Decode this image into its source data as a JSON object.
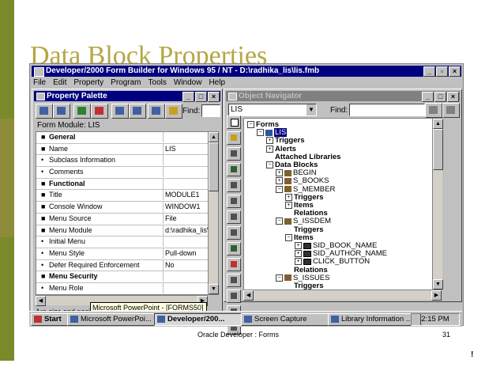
{
  "slide": {
    "title": "Data Block Properties",
    "footer": "Oracle Developer : Forms",
    "page_number": "31",
    "corner_mark": "!"
  },
  "app": {
    "title": "Developer/2000 Form Builder for Windows 95 / NT - D:\\radhika_lis\\lis.fmb",
    "menu": [
      "File",
      "Edit",
      "Property",
      "Program",
      "Tools",
      "Window",
      "Help"
    ]
  },
  "property_palette": {
    "title": "Property Palette",
    "find_label": "Find:",
    "find_value": "",
    "context_label": "Form Module: LIS",
    "rows": [
      {
        "kind": "section",
        "mark": "■",
        "name": "General",
        "value": ""
      },
      {
        "kind": "prop",
        "mark": "■",
        "name": "Name",
        "value": "LIS"
      },
      {
        "kind": "prop",
        "mark": "•",
        "name": "Subclass Information",
        "value": ""
      },
      {
        "kind": "prop",
        "mark": "•",
        "name": "Comments",
        "value": ""
      },
      {
        "kind": "section",
        "mark": "■",
        "name": "Functional",
        "value": ""
      },
      {
        "kind": "prop",
        "mark": "■",
        "name": "Title",
        "value": "MODULE1"
      },
      {
        "kind": "prop",
        "mark": "■",
        "name": "Console Window",
        "value": "WINDOW1"
      },
      {
        "kind": "prop",
        "mark": "■",
        "name": "Menu Source",
        "value": "File"
      },
      {
        "kind": "prop",
        "mark": "■",
        "name": "Menu Module",
        "value": "d:\\radhika_lis\\l"
      },
      {
        "kind": "prop",
        "mark": "•",
        "name": "Initial Menu",
        "value": ""
      },
      {
        "kind": "prop",
        "mark": "•",
        "name": "Menu Style",
        "value": "Pull-down"
      },
      {
        "kind": "prop",
        "mark": "•",
        "name": "Defer Required Enforcement",
        "value": "No"
      },
      {
        "kind": "section",
        "mark": "■",
        "name": "Menu Security",
        "value": ""
      },
      {
        "kind": "prop",
        "mark": "•",
        "name": "Menu Role",
        "value": ""
      }
    ],
    "hint": "Are size and position values given in character cell va"
  },
  "object_navigator": {
    "title": "Object Navigator",
    "module_select": "LIS",
    "find_label": "Find:",
    "find_value": "",
    "tree": [
      {
        "indent": 0,
        "pm": "−",
        "icon": "",
        "text": "Forms",
        "bold": true,
        "selected": false
      },
      {
        "indent": 1,
        "pm": "−",
        "icon": "form",
        "text": "LIS",
        "bold": false,
        "selected": true
      },
      {
        "indent": 2,
        "pm": "+",
        "icon": "",
        "text": "Triggers",
        "bold": true,
        "selected": false
      },
      {
        "indent": 2,
        "pm": "+",
        "icon": "",
        "text": "Alerts",
        "bold": true,
        "selected": false
      },
      {
        "indent": 2,
        "pm": "",
        "icon": "",
        "text": "Attached Libraries",
        "bold": true,
        "selected": false
      },
      {
        "indent": 2,
        "pm": "−",
        "icon": "",
        "text": "Data Blocks",
        "bold": true,
        "selected": false
      },
      {
        "indent": 3,
        "pm": "+",
        "icon": "block",
        "text": "BEGIN",
        "bold": false,
        "selected": false
      },
      {
        "indent": 3,
        "pm": "+",
        "icon": "block",
        "text": "S_BOOKS",
        "bold": false,
        "selected": false
      },
      {
        "indent": 3,
        "pm": "−",
        "icon": "block",
        "text": "S_MEMBER",
        "bold": false,
        "selected": false
      },
      {
        "indent": 4,
        "pm": "+",
        "icon": "",
        "text": "Triggers",
        "bold": true,
        "selected": false
      },
      {
        "indent": 4,
        "pm": "+",
        "icon": "",
        "text": "Items",
        "bold": true,
        "selected": false
      },
      {
        "indent": 4,
        "pm": "",
        "icon": "",
        "text": "Relations",
        "bold": true,
        "selected": false
      },
      {
        "indent": 3,
        "pm": "−",
        "icon": "block",
        "text": "S_ISSDEM",
        "bold": false,
        "selected": false
      },
      {
        "indent": 4,
        "pm": "",
        "icon": "",
        "text": "Triggers",
        "bold": true,
        "selected": false
      },
      {
        "indent": 4,
        "pm": "−",
        "icon": "",
        "text": "Items",
        "bold": true,
        "selected": false
      },
      {
        "indent": 5,
        "pm": "+",
        "icon": "item",
        "text": "SID_BOOK_NAME",
        "bold": false,
        "selected": false
      },
      {
        "indent": 5,
        "pm": "+",
        "icon": "item",
        "text": "SID_AUTHOR_NAME",
        "bold": false,
        "selected": false
      },
      {
        "indent": 5,
        "pm": "+",
        "icon": "item",
        "text": "CLICK_BUTTON",
        "bold": false,
        "selected": false
      },
      {
        "indent": 4,
        "pm": "",
        "icon": "",
        "text": "Relations",
        "bold": true,
        "selected": false
      },
      {
        "indent": 3,
        "pm": "−",
        "icon": "block",
        "text": "S_ISSUES",
        "bold": false,
        "selected": false
      },
      {
        "indent": 4,
        "pm": "",
        "icon": "",
        "text": "Triggers",
        "bold": true,
        "selected": false
      }
    ]
  },
  "tooltip": "Microsoft PowerPoint - [FORMS50]",
  "taskbar": {
    "start": "Start",
    "tasks": [
      {
        "label": "Microsoft PowerPoi...",
        "active": false
      },
      {
        "label": "Developer/200...",
        "active": true
      },
      {
        "label": "Screen Capture",
        "active": false
      },
      {
        "label": "Library Information ...",
        "active": false
      }
    ],
    "clock": "2:15 PM"
  }
}
